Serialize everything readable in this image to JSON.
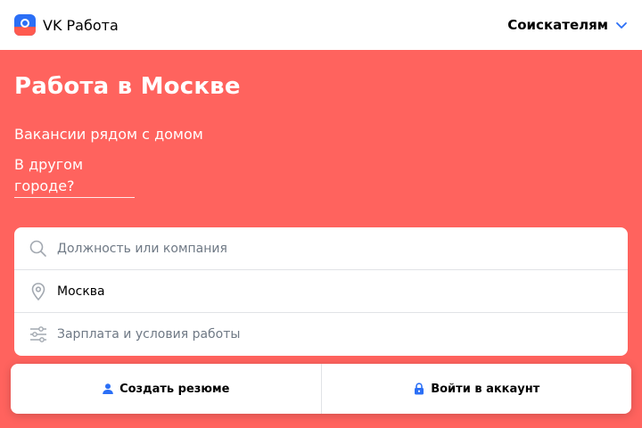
{
  "header": {
    "brand_name": "VK Работа",
    "menu_label": "Соискателям",
    "logo_icon": "vk-rabota-logo",
    "chevron_icon": "chevron-down-icon"
  },
  "hero": {
    "title": "Работа в Москве",
    "subtitle": "Вакансии рядом с домом",
    "other_city_link": "В другом городе?"
  },
  "search": {
    "position_placeholder": "Должность или компания",
    "city_value": "Москва",
    "filters_label": "Зарплата и условия работы",
    "icons": [
      "search-icon",
      "location-pin-icon",
      "sliders-icon"
    ]
  },
  "actions": {
    "create_resume": "Создать резюме",
    "login": "Войти в аккаунт",
    "icons": [
      "user-icon",
      "lock-icon"
    ]
  },
  "colors": {
    "accent_red": "#ff635e",
    "accent_blue": "#2b6ff6",
    "card_bg": "#ffffff"
  }
}
